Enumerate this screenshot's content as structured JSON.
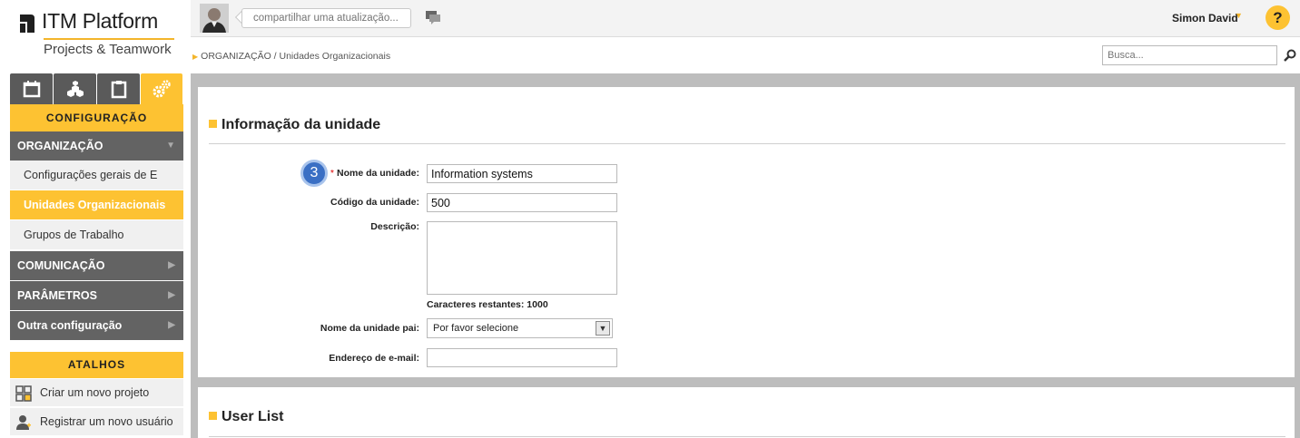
{
  "brand": {
    "title": "ITM Platform",
    "subtitle": "Projects & Teamwork",
    "accent": "#fdc232"
  },
  "topbar": {
    "share_placeholder": "compartilhar uma atualização...",
    "user_name": "Simon David",
    "help_label": "?",
    "icons": [
      "avatar",
      "chat-icon",
      "chevron-down-icon",
      "help-icon"
    ]
  },
  "sidebar": {
    "tabs": [
      {
        "icon": "calendar-icon"
      },
      {
        "icon": "cubes-icon"
      },
      {
        "icon": "clipboard-icon"
      },
      {
        "icon": "gears-icon",
        "active": true
      }
    ],
    "config_title": "CONFIGURAÇÃO",
    "sections": [
      {
        "label": "ORGANIZAÇÃO",
        "expanded": true
      },
      {
        "label": "COMUNICAÇÃO"
      },
      {
        "label": "PARÂMETROS"
      },
      {
        "label": "Outra configuração"
      }
    ],
    "org_items": [
      {
        "label": "Configurações gerais de E"
      },
      {
        "label": "Unidades Organizacionais",
        "active": true
      },
      {
        "label": "Grupos de Trabalho"
      }
    ],
    "shortcuts_title": "ATALHOS",
    "shortcuts": [
      {
        "label": "Criar um novo projeto",
        "icon": "grid-icon"
      },
      {
        "label": "Registrar um novo usuário",
        "icon": "user-icon"
      }
    ]
  },
  "breadcrumb": {
    "text": "ORGANIZAÇÃO / Unidades Organizacionais"
  },
  "search": {
    "placeholder": "Busca..."
  },
  "form": {
    "section_title": "Informação da unidade",
    "step_number": "3",
    "required_mark": "*",
    "fields": {
      "name": {
        "label": "Nome da unidade:",
        "value": "Information systems"
      },
      "code": {
        "label": "Código da unidade:",
        "value": "500"
      },
      "description": {
        "label": "Descrição:",
        "value": ""
      },
      "chars_left": "Caracteres restantes: 1000",
      "parent": {
        "label": "Nome da unidade pai:",
        "value": "Por favor selecione"
      },
      "email": {
        "label": "Endereço de e-mail:",
        "value": ""
      }
    }
  },
  "user_list": {
    "section_title": "User List"
  }
}
